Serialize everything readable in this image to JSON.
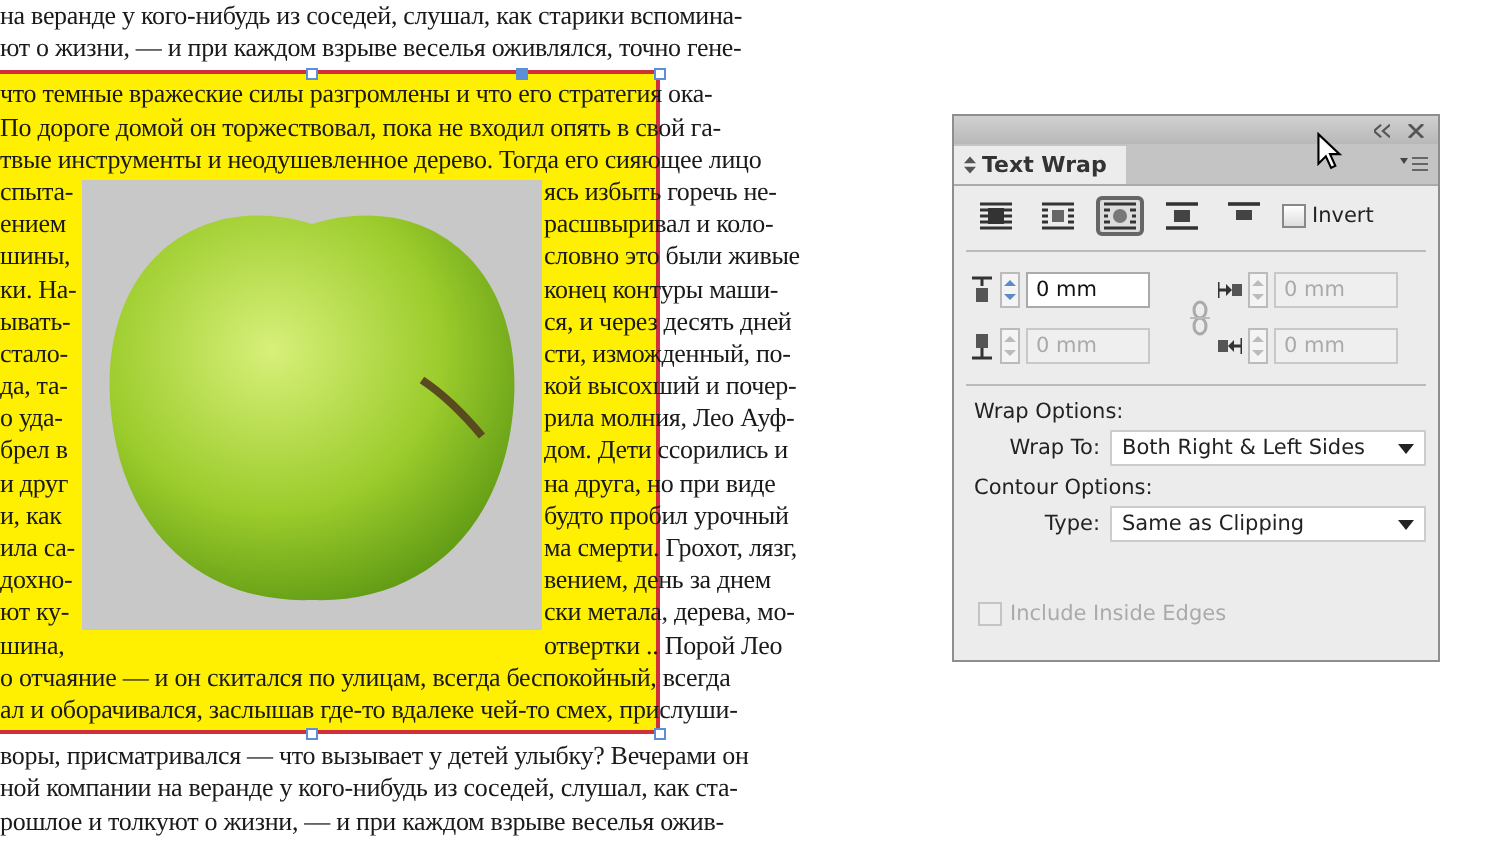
{
  "document": {
    "lines": [
      {
        "kind": "full",
        "text": "на веранде у кого-нибудь из соседей, слушал, как старики вспомина-"
      },
      {
        "kind": "full",
        "text": "ют о жизни, — и при каждом взрыве веселья оживлялся, точно гене-"
      },
      {
        "kind": "full",
        "text": "что темные вражеские силы разгромлены и что его стратегия ока-"
      },
      {
        "kind": "full",
        "text": "  По дороге домой он торжествовал, пока не входил опять в свой га-"
      },
      {
        "kind": "full",
        "text": "твые инструменты и неодушевленное дерево. Тогда его сияющее лицо"
      },
      {
        "kind": "split",
        "left": "спыта-",
        "right": "ясь избыть горечь не-"
      },
      {
        "kind": "split",
        "left": "ением",
        "right": "расшвыривал и коло-"
      },
      {
        "kind": "split",
        "left": "шины,",
        "right": "словно это были живые"
      },
      {
        "kind": "split",
        "left": "ки. На-",
        "right": "конец контуры маши-"
      },
      {
        "kind": "split",
        "left": "ывать-",
        "right": "ся, и через десять дней"
      },
      {
        "kind": "split",
        "left": "стало-",
        "right": "сти, изможденный, по-"
      },
      {
        "kind": "split",
        "left": "да, та-",
        "right": "кой высохший и почер-"
      },
      {
        "kind": "split",
        "left": "о уда-",
        "right": "рила молния, Лео Ауф-"
      },
      {
        "kind": "split",
        "left": "брел в",
        "right": "дом.  Дети ссорились и"
      },
      {
        "kind": "split",
        "left": "и друг",
        "right": "на друга, но при виде"
      },
      {
        "kind": "split",
        "left": "и, как",
        "right": "будто пробил урочный"
      },
      {
        "kind": "split",
        "left": "ила са-",
        "right": "ма смерти. Грохот, лязг,"
      },
      {
        "kind": "split",
        "left": "дохно-",
        "right": "вением, день за днем"
      },
      {
        "kind": "split",
        "left": "ют ку-",
        "right": "ски метала, дерева, мо-"
      },
      {
        "kind": "split",
        "left": "шина,",
        "right": "отвертки .. Порой Лео"
      },
      {
        "kind": "full",
        "text": "о отчаяние — и он скитался по улицам, всегда беспокойный, всегда"
      },
      {
        "kind": "full",
        "text": "ал и оборачивался, заслышав где-то вдалеке чей-то смех, прислуши-"
      },
      {
        "kind": "full",
        "text": "воры, присматривался — что вызывает у детей улыбку? Вечерами он"
      },
      {
        "kind": "full",
        "text": "ной компании на веранде у кого-нибудь из соседей, слушал, как ста-"
      },
      {
        "kind": "full",
        "text": "рошлое и толкуют о жизни, — и при каждом взрыве веселья ожив-"
      }
    ]
  },
  "panel": {
    "title": "Text Wrap",
    "wrap_modes": [
      {
        "selected": false
      },
      {
        "selected": false
      },
      {
        "selected": true
      },
      {
        "selected": false
      },
      {
        "selected": false
      }
    ],
    "invert": {
      "label": "Invert",
      "checked": false
    },
    "offsets": [
      {
        "value": "0 mm",
        "disabled": false
      },
      {
        "value": "0 mm",
        "disabled": true
      },
      {
        "value": "0 mm",
        "disabled": true
      },
      {
        "value": "0 mm",
        "disabled": true
      }
    ],
    "wrap_options": {
      "heading": "Wrap Options:",
      "label": "Wrap To:",
      "value": "Both Right & Left Sides"
    },
    "contour_options": {
      "heading": "Contour Options:",
      "label": "Type:",
      "value": "Same as Clipping"
    },
    "include_inside_edges": {
      "label": "Include Inside Edges",
      "checked": false,
      "disabled": true
    }
  }
}
